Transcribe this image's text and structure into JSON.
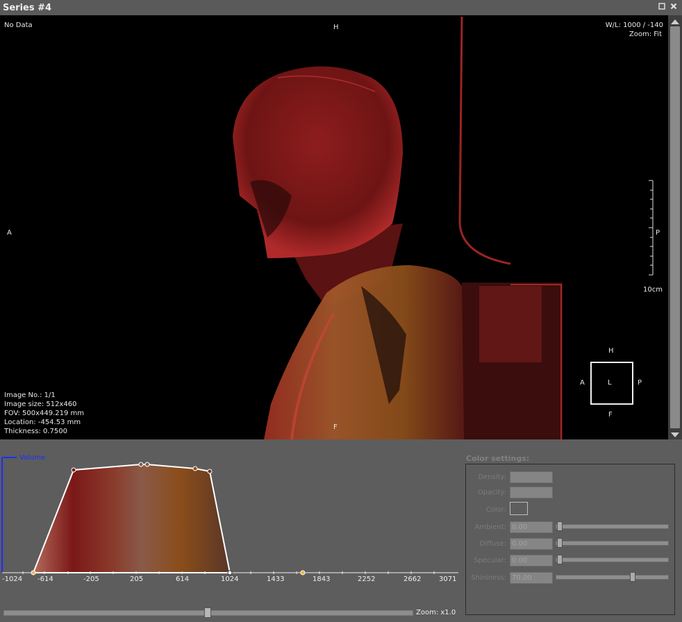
{
  "window": {
    "title": "Series #4"
  },
  "viewport": {
    "top_left": "No Data",
    "top_center": "H",
    "top_right_wl": "W/L: 1000 / -140",
    "top_right_zoom": "Zoom: Fit",
    "left_mid": "A",
    "right_mid": "P",
    "scale_label": "10cm",
    "bottom_center": "F",
    "info": {
      "image_no": "Image No.: 1/1",
      "image_size": "Image size: 512x460",
      "fov": "FOV: 500x449.219 mm",
      "location": "Location: -454.53 mm",
      "thickness": "Thickness: 0.7500"
    },
    "cube": {
      "top": "H",
      "left": "A",
      "center": "L",
      "right": "P",
      "bottom": "F"
    }
  },
  "transfer_function": {
    "label": "Volume",
    "ticks": [
      "-1024",
      "-614",
      "-205",
      "205",
      "614",
      "1024",
      "1433",
      "1843",
      "2252",
      "2662",
      "3071"
    ],
    "zoom_label": "Zoom: x1.0",
    "zoom_value": 1.0
  },
  "color_settings": {
    "title": "Color settings:",
    "density_label": "Density:",
    "opacity_label": "Opacity:",
    "color_label": "Color:",
    "ambient_label": "Ambient:",
    "ambient_value": "0.00",
    "diffuse_label": "Diffuse:",
    "diffuse_value": "0.00",
    "specular_label": "Specular:",
    "specular_value": "0.00",
    "shininess_label": "Shininess:",
    "shininess_value": "70.00"
  },
  "colors": {
    "tf_axis": "#1d2cff",
    "volume_dark_red": "#7a1818",
    "volume_orange": "#8a4d1a"
  }
}
